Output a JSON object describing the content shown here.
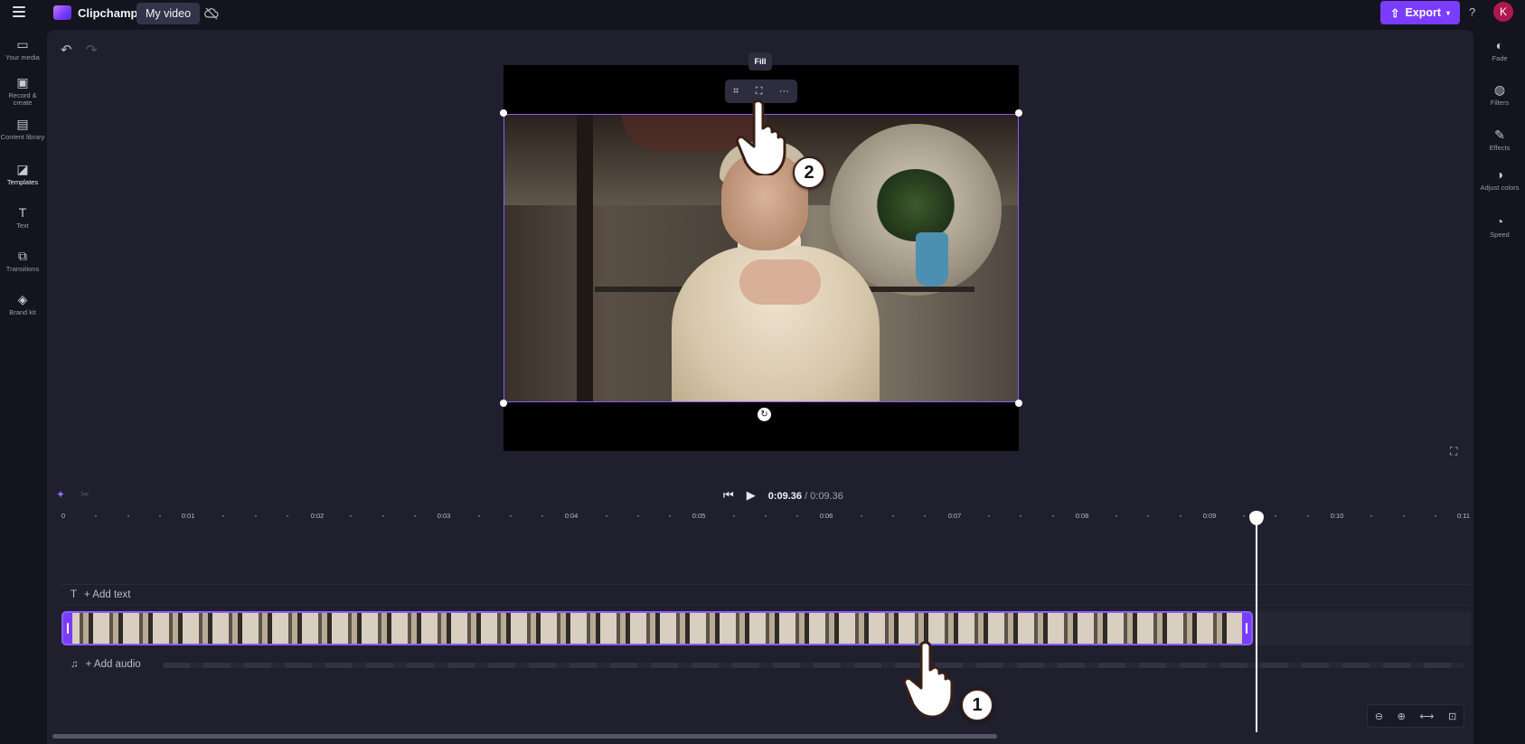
{
  "app": {
    "name": "Clipchamp",
    "project_title": "My video",
    "export_label": "Export",
    "help": "?",
    "avatar_initial": "K",
    "accent": "#7a3cff"
  },
  "left_rail": [
    {
      "label": "Your media",
      "icon": "folder-icon"
    },
    {
      "label": "Record & create",
      "icon": "camera-icon"
    },
    {
      "label": "Content library",
      "icon": "library-icon"
    },
    {
      "label": "Templates",
      "icon": "templates-icon"
    },
    {
      "label": "Text",
      "icon": "text-icon"
    },
    {
      "label": "Transitions",
      "icon": "transitions-icon"
    },
    {
      "label": "Brand kit",
      "icon": "brand-kit-icon"
    }
  ],
  "right_rail": [
    {
      "label": "Fade",
      "icon": "fade-icon"
    },
    {
      "label": "Filters",
      "icon": "filters-icon"
    },
    {
      "label": "Effects",
      "icon": "effects-icon"
    },
    {
      "label": "Adjust colors",
      "icon": "adjust-colors-icon"
    },
    {
      "label": "Speed",
      "icon": "speed-icon"
    }
  ],
  "preview": {
    "tooltip": "Fill",
    "toolbar": [
      "crop-icon",
      "fill-icon",
      "more-icon"
    ]
  },
  "annotations": {
    "step1": "1",
    "step2": "2"
  },
  "transport": {
    "current_time": "0:09.36",
    "total_time": " / 0:09.36"
  },
  "ruler": {
    "labels": [
      "0",
      "0:01",
      "0:02",
      "0:03",
      "0:04",
      "0:05",
      "0:06",
      "0:07",
      "0:08",
      "0:09",
      "0:10",
      "0:11"
    ]
  },
  "tracks": {
    "add_text": "+ Add text",
    "add_audio": "+ Add audio"
  }
}
